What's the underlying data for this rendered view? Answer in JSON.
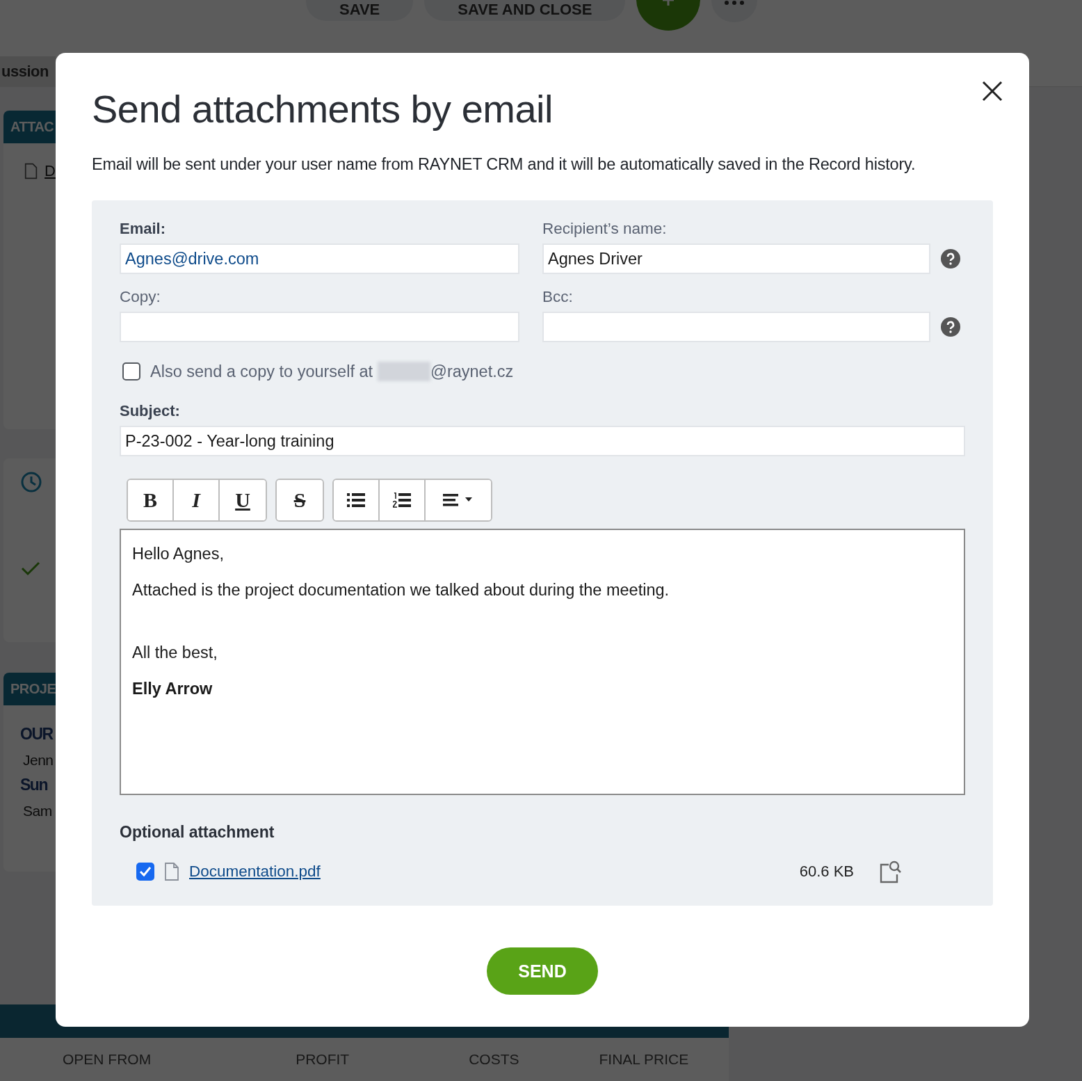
{
  "background": {
    "toolbar": {
      "buttons": [
        "SAVE",
        "SAVE AND CLOSE"
      ]
    },
    "side_tab": "ussion",
    "attachments_card": {
      "header": "ATTAC",
      "file_link": "D"
    },
    "project_card": {
      "header": "PROJE",
      "lines": [
        {
          "text": "OUR",
          "kind": "heading"
        },
        {
          "text": "Jenn",
          "kind": "text"
        },
        {
          "text": "Sun",
          "kind": "heading"
        },
        {
          "text": "Sam",
          "kind": "text"
        }
      ]
    },
    "footer_columns": [
      "OPEN FROM",
      "PROFIT",
      "COSTS",
      "FINAL PRICE"
    ]
  },
  "dialog": {
    "title": "Send attachments by email",
    "intro": "Email will be sent under your user name from RAYNET CRM and it will be automatically saved in the Record history.",
    "fields": [
      {
        "label": "Email:",
        "value": "Agnes@drive.com",
        "kind": "email",
        "required": true,
        "help": false
      },
      {
        "label": "Recipient’s name:",
        "value": "Agnes Driver",
        "kind": "text",
        "required": false,
        "help": true
      },
      {
        "label": "Copy:",
        "kind": "text",
        "required": false,
        "help": false
      },
      {
        "label": "Bcc:",
        "kind": "text",
        "required": false,
        "help": true
      }
    ],
    "copy_to_self": {
      "checked": false,
      "label": "Also send a copy to yourself at",
      "address_suffix": "@raynet.cz"
    },
    "subject": {
      "label": "Subject:",
      "value": "P-23-002 - Year-long training",
      "required": true
    },
    "toolbar": [
      [
        {
          "kind": "bold",
          "label": "B"
        },
        {
          "kind": "italic",
          "label": "I"
        },
        {
          "kind": "underline",
          "label": "U"
        }
      ],
      [
        {
          "kind": "strike",
          "label": "S"
        }
      ],
      [
        {
          "kind": "bullets"
        },
        {
          "kind": "numbers"
        },
        {
          "kind": "align"
        }
      ]
    ],
    "body": {
      "message": [
        "Hello Agnes,",
        "Attached is the project documentation we talked about during the meeting."
      ],
      "closing": [
        "All the best,"
      ],
      "signature": "Elly Arrow"
    },
    "attachment": {
      "heading": "Optional attachment",
      "files": [
        {
          "name": "Documentation.pdf",
          "size": "60.6 KB",
          "checked": true
        }
      ]
    },
    "send": "SEND"
  }
}
